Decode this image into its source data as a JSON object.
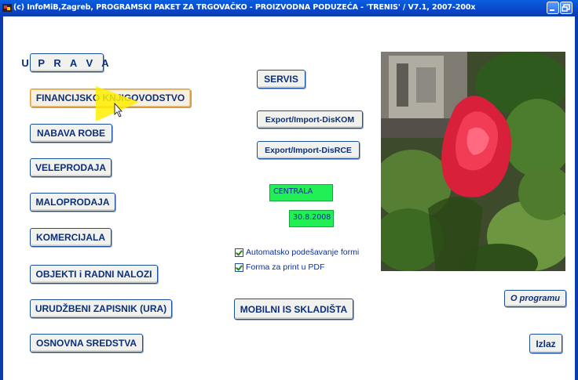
{
  "window": {
    "title": "(c) InfoMiB,Zagreb, PROGRAMSKI PAKET ZA TRGOVAČKO - PROIZVODNA PODUZEĆA - 'TRENIS' / V7.1, 2007-200x"
  },
  "left_menu": {
    "uprava": "U P R A V A",
    "financijsko": "FINANCIJSKO KNJIGOVODSTVO",
    "nabava": "NABAVA ROBE",
    "veleprodaja": "VELEPRODAJA",
    "maloprodaja": "MALOPRODAJA",
    "komercijala": "KOMERCIJALA",
    "objekti": "OBJEKTI i RADNI NALOZI",
    "urudzbeni": "URUDŽBENI ZAPISNIK (URA)",
    "osnovna": "OSNOVNA SREDSTVA"
  },
  "middle": {
    "servis": "SERVIS",
    "export_diskom": "Export/Import-DisKOM",
    "export_disrce": "Export/Import-DisRCE",
    "location": "CENTRALA",
    "date": "30.8.2008",
    "auto_forms": "Automatsko podešavanje formi",
    "print_pdf": "Forma za print u PDF",
    "mobilni": "MOBILNI IS SKLADIŠTA"
  },
  "right": {
    "about": "O programu",
    "exit": "Izlaz"
  },
  "colors": {
    "titlebar": "#0847c8",
    "button_text": "#0b2f7a",
    "status_green": "#22ee55"
  }
}
